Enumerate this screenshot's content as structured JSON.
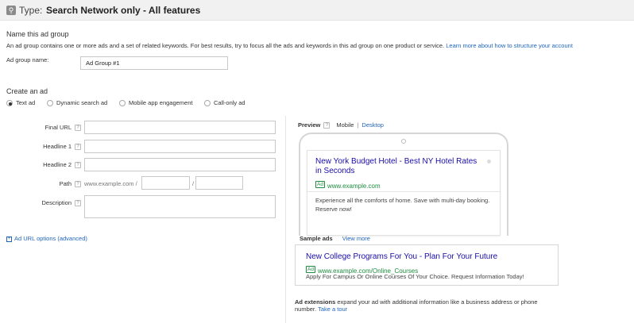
{
  "type_bar": {
    "icon": "search-icon",
    "label": "Type:",
    "value": "Search Network only - All features"
  },
  "name_section": {
    "title": "Name this ad group",
    "description": "An ad group contains one or more ads and a set of related keywords. For best results, try to focus all the ads and keywords in this ad group on one product or service.",
    "learn_more": "Learn more about how to structure your account",
    "ad_group_name_label": "Ad group name:",
    "ad_group_name_value": "Ad Group #1"
  },
  "create_ad": {
    "title": "Create an ad",
    "options": [
      {
        "label": "Text ad",
        "selected": true
      },
      {
        "label": "Dynamic search ad",
        "selected": false
      },
      {
        "label": "Mobile app engagement",
        "selected": false
      },
      {
        "label": "Call-only ad",
        "selected": false
      }
    ]
  },
  "form": {
    "final_url_label": "Final URL",
    "headline1_label": "Headline 1",
    "headline2_label": "Headline 2",
    "path_label": "Path",
    "path_prefix": "www.example.com /",
    "path_separator": "/",
    "description_label": "Description",
    "help_glyph": "?",
    "url_options": "Ad URL options (advanced)",
    "url_options_icon": "plus-box-icon"
  },
  "preview": {
    "label": "Preview",
    "tab_mobile": "Mobile",
    "separator": "|",
    "tab_desktop": "Desktop",
    "headline": "New York Budget Hotel - Best NY Hotel Rates in Seconds",
    "badge": "Ad",
    "url": "www.example.com",
    "description": "Experience all the comforts of home. Save with multi-day booking. Reserve now!"
  },
  "sample_ads": {
    "label": "Sample ads",
    "view_more": "View more",
    "headline": "New College Programs For You - Plan For Your Future",
    "badge": "Ad",
    "url": "www.example.com/Online_Courses",
    "description": "Apply For Campus Or Online Courses Of Your Choice. Request Information Today!"
  },
  "ad_extensions": {
    "bold": "Ad extensions",
    "text": "expand your ad with additional information like a business address or phone number.",
    "link": "Take a tour"
  },
  "colors": {
    "link": "#2266bb",
    "ad_headline": "#1a0dab",
    "ad_url": "#1e8d3f"
  }
}
